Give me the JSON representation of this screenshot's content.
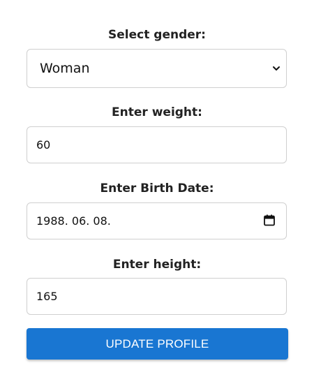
{
  "gender": {
    "label": "Select gender:",
    "selected": "Woman"
  },
  "weight": {
    "label": "Enter weight:",
    "value": "60"
  },
  "birth_date": {
    "label": "Enter Birth Date:",
    "value": "1988. 06. 08."
  },
  "height": {
    "label": "Enter height:",
    "value": "165"
  },
  "submit": {
    "label": "UPDATE PROFILE"
  },
  "colors": {
    "button": "#1976d2",
    "border": "#cfcfcf"
  },
  "icons": {
    "select": "chevron-down-icon",
    "date": "calendar-icon"
  }
}
